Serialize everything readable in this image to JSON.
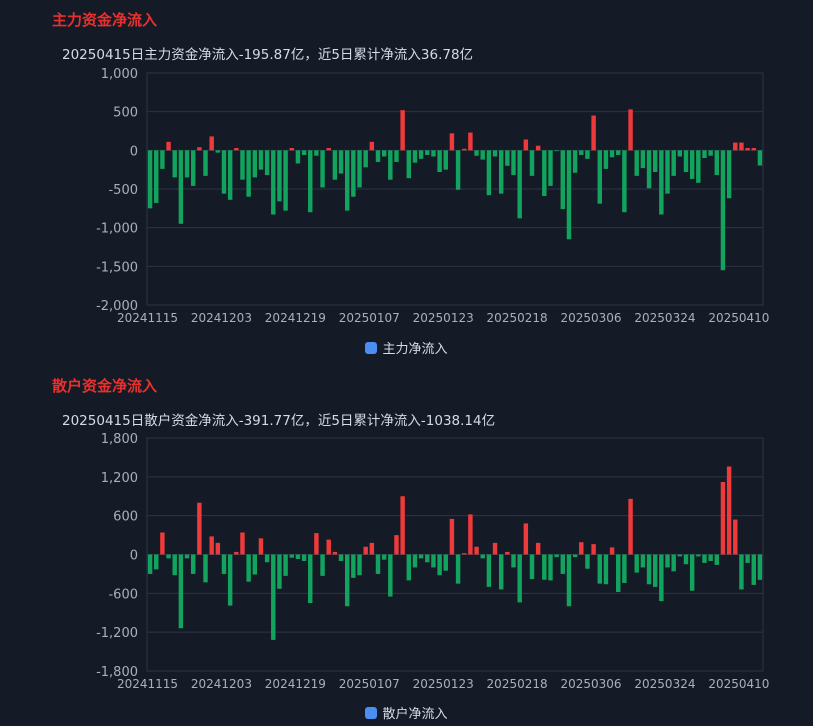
{
  "colors": {
    "background": "#141a26",
    "title": "#e8312f",
    "positive": "#ee3a3a",
    "negative": "#12a35e",
    "legend": "#4a8ff0",
    "grid": "#2c3444",
    "axis_text": "#a9b0bc"
  },
  "chart_data": [
    {
      "type": "bar",
      "title": "主力资金净流入",
      "subtitle": "20250415日主力资金净流入-195.87亿，近5日累计净流入36.78亿",
      "legend": [
        "主力净流入"
      ],
      "ylim": [
        -2000,
        1000
      ],
      "yticks": [
        "1,000",
        "500",
        "0",
        "-500",
        "-1,000",
        "-1,500",
        "-2,000"
      ],
      "ytick_values": [
        1000,
        500,
        0,
        -500,
        -1000,
        -1500,
        -2000
      ],
      "xtick_labels": [
        {
          "index": 0,
          "label": "20241115"
        },
        {
          "index": 12,
          "label": "20241203"
        },
        {
          "index": 24,
          "label": "20241219"
        },
        {
          "index": 36,
          "label": "20250107"
        },
        {
          "index": 48,
          "label": "20250123"
        },
        {
          "index": 60,
          "label": "20250218"
        },
        {
          "index": 72,
          "label": "20250306"
        },
        {
          "index": 84,
          "label": "20250324"
        },
        {
          "index": 96,
          "label": "20250410"
        }
      ],
      "grid": true,
      "legend_position": "bottom",
      "series": [
        {
          "name": "主力净流入",
          "values": [
            -750,
            -680,
            -240,
            110,
            -350,
            -950,
            -350,
            -460,
            40,
            -330,
            180,
            -30,
            -560,
            -640,
            30,
            -380,
            -600,
            -350,
            -250,
            -320,
            -830,
            -660,
            -780,
            30,
            -170,
            -60,
            -800,
            -70,
            -480,
            30,
            -380,
            -300,
            -780,
            -600,
            -480,
            -220,
            110,
            -150,
            -80,
            -380,
            -150,
            520,
            -360,
            -160,
            -110,
            -60,
            -80,
            -280,
            -250,
            220,
            -510,
            20,
            230,
            -70,
            -120,
            -580,
            -80,
            -560,
            -200,
            -320,
            -880,
            140,
            -330,
            60,
            -590,
            -460,
            -10,
            -760,
            -1150,
            -290,
            -60,
            -110,
            450,
            -690,
            -240,
            -90,
            -60,
            -800,
            530,
            -330,
            -230,
            -490,
            -280,
            -830,
            -560,
            -330,
            -80,
            -280,
            -370,
            -420,
            -100,
            -70,
            -320,
            -1550,
            -620,
            100,
            100,
            30,
            30,
            -196
          ]
        }
      ]
    },
    {
      "type": "bar",
      "title": "散户资金净流入",
      "subtitle": "20250415日散户资金净流入-391.77亿，近5日累计净流入-1038.14亿",
      "legend": [
        "散户净流入"
      ],
      "ylim": [
        -1800,
        1800
      ],
      "yticks": [
        "1,800",
        "1,200",
        "600",
        "0",
        "-600",
        "-1,200",
        "-1,800"
      ],
      "ytick_values": [
        1800,
        1200,
        600,
        0,
        -600,
        -1200,
        -1800
      ],
      "xtick_labels": [
        {
          "index": 0,
          "label": "20241115"
        },
        {
          "index": 12,
          "label": "20241203"
        },
        {
          "index": 24,
          "label": "20241219"
        },
        {
          "index": 36,
          "label": "20250107"
        },
        {
          "index": 48,
          "label": "20250123"
        },
        {
          "index": 60,
          "label": "20250218"
        },
        {
          "index": 72,
          "label": "20250306"
        },
        {
          "index": 84,
          "label": "20250324"
        },
        {
          "index": 96,
          "label": "20250410"
        }
      ],
      "grid": true,
      "legend_position": "bottom",
      "series": [
        {
          "name": "散户净流入",
          "values": [
            -300,
            -230,
            340,
            -60,
            -320,
            -1140,
            -60,
            -300,
            800,
            -430,
            280,
            180,
            -300,
            -790,
            40,
            340,
            -420,
            -310,
            250,
            -120,
            -1320,
            -530,
            -330,
            -50,
            -70,
            -100,
            -750,
            330,
            -330,
            230,
            40,
            -100,
            -800,
            -360,
            -320,
            120,
            180,
            -300,
            -80,
            -650,
            300,
            900,
            -400,
            -200,
            -60,
            -120,
            -200,
            -320,
            -250,
            550,
            -450,
            20,
            620,
            120,
            -60,
            -500,
            180,
            -540,
            40,
            -200,
            -740,
            480,
            -380,
            180,
            -390,
            -400,
            -40,
            -300,
            -800,
            -40,
            190,
            -220,
            160,
            -450,
            -460,
            110,
            -580,
            -440,
            860,
            -280,
            -200,
            -460,
            -500,
            -720,
            -200,
            -260,
            -30,
            -150,
            -560,
            -30,
            -130,
            -100,
            -160,
            1120,
            1360,
            540,
            -540,
            -130,
            -470,
            -392
          ]
        }
      ]
    }
  ]
}
